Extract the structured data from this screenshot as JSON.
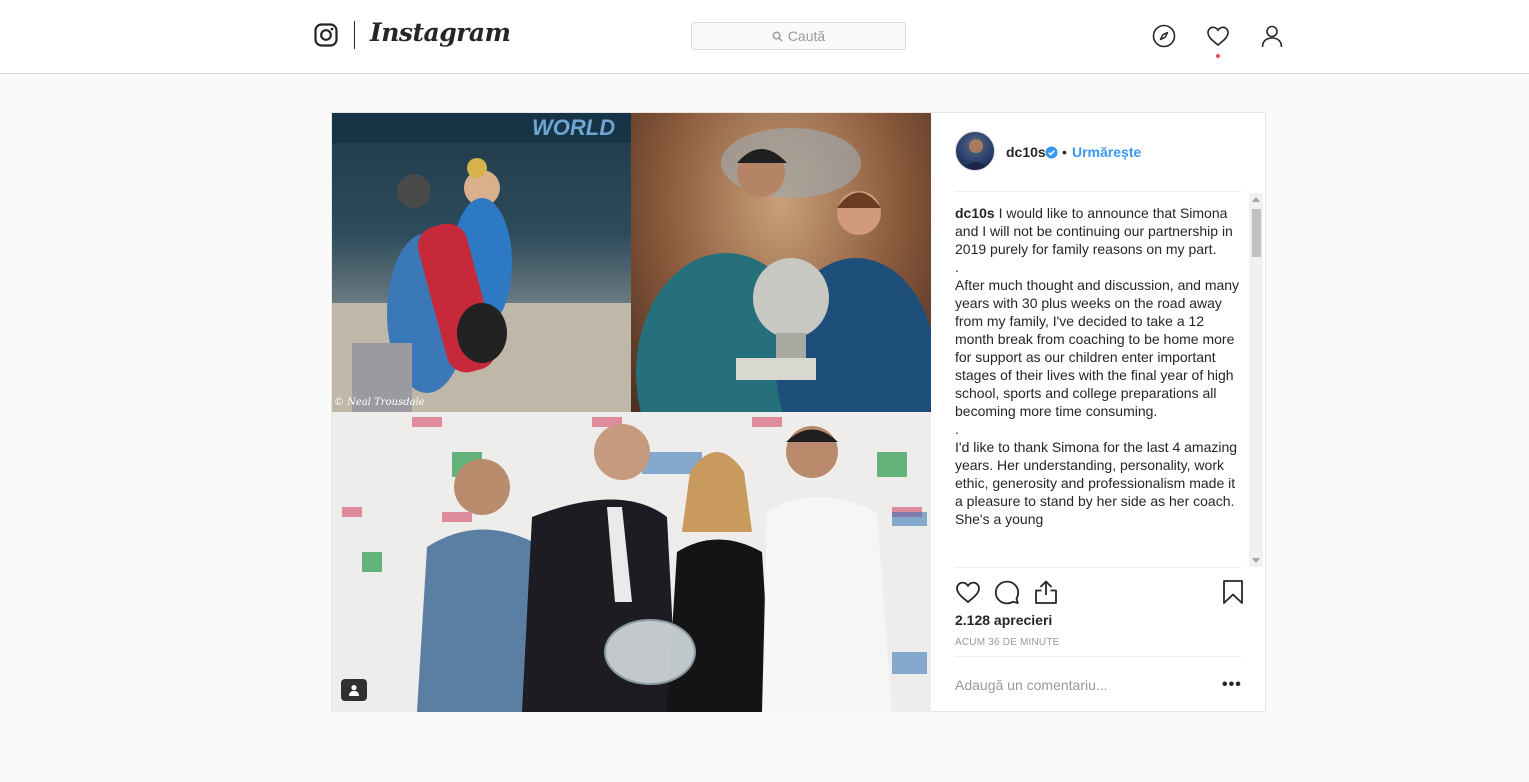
{
  "nav": {
    "logo_text": "Instagram",
    "search_placeholder": "Caută"
  },
  "post": {
    "username": "dc10s",
    "verified": true,
    "separator": "•",
    "follow_label": "Urmărește",
    "photo_credit": "© Neal Trousdale",
    "caption_username": "dc10s",
    "caption_paragraphs": [
      "I would like to announce that Simona and I will not be continuing our partnership in 2019 purely for family reasons on my part.",
      ".",
      "After much thought and discussion, and many years with 30 plus weeks on the road away from my family, I've decided to take a 12 month break from coaching to be home more for support as our children enter important stages of their lives with the final year of high school, sports and college preparations all becoming more time consuming.",
      ".",
      "I'd like to thank Simona for the last 4 amazing years. Her understanding, personality, work ethic, generosity and professionalism made it a pleasure to stand by her side as her coach. She's a young"
    ],
    "likes": "2.128 aprecieri",
    "timestamp": "ACUM 36 DE MINUTE",
    "comment_placeholder": "Adaugă un comentariu...",
    "more_label": "•••"
  },
  "icons": {
    "logo": "instagram-camera-icon",
    "search": "search-icon",
    "explore": "compass-icon",
    "activity": "heart-icon",
    "profile": "user-icon",
    "like": "heart-outline-icon",
    "comment": "comment-icon",
    "share": "share-icon",
    "save": "bookmark-icon",
    "tagged": "user-tag-icon"
  },
  "colors": {
    "link": "#3897f0",
    "notification_dot": "#ed4956",
    "text": "#262626",
    "muted": "#999999"
  }
}
